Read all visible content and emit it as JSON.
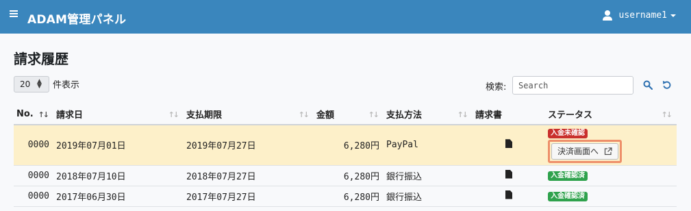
{
  "navbar": {
    "brand": "ADAM管理パネル",
    "username": "username1"
  },
  "page": {
    "title": "請求履歴"
  },
  "controls": {
    "page_length": "20",
    "page_length_label": "件表示",
    "search_label": "検索:",
    "search_placeholder": "Search"
  },
  "table": {
    "headers": [
      "No.",
      "請求日",
      "支払期限",
      "金額",
      "支払方法",
      "請求書",
      "ステータス"
    ],
    "rows": [
      {
        "no": "0000",
        "billing_date": "2019年07月01日",
        "due_date": "2019年07月27日",
        "amount": "6,280円",
        "method": "PayPal",
        "status": "入金未確認",
        "status_color": "#c9302c",
        "action": "決済画面へ"
      },
      {
        "no": "0000",
        "billing_date": "2018年07月10日",
        "due_date": "2018年07月27日",
        "amount": "6,280円",
        "method": "銀行振込",
        "status": "入金確認済",
        "status_color": "#2fa24d"
      },
      {
        "no": "0000",
        "billing_date": "2017年06月30日",
        "due_date": "2017年07月27日",
        "amount": "6,280円",
        "method": "銀行振込",
        "status": "入金確認済",
        "status_color": "#2fa24d"
      }
    ]
  },
  "icons": {
    "menu": "hamburger-icon",
    "user": "user-icon",
    "search": "search-icon",
    "reload": "reload-icon",
    "document": "document-icon",
    "external": "external-link-icon"
  },
  "colors": {
    "navbar": "#3a86bd",
    "highlight_row": "#fdf0c9",
    "focus_outline": "#ee8f6a"
  }
}
